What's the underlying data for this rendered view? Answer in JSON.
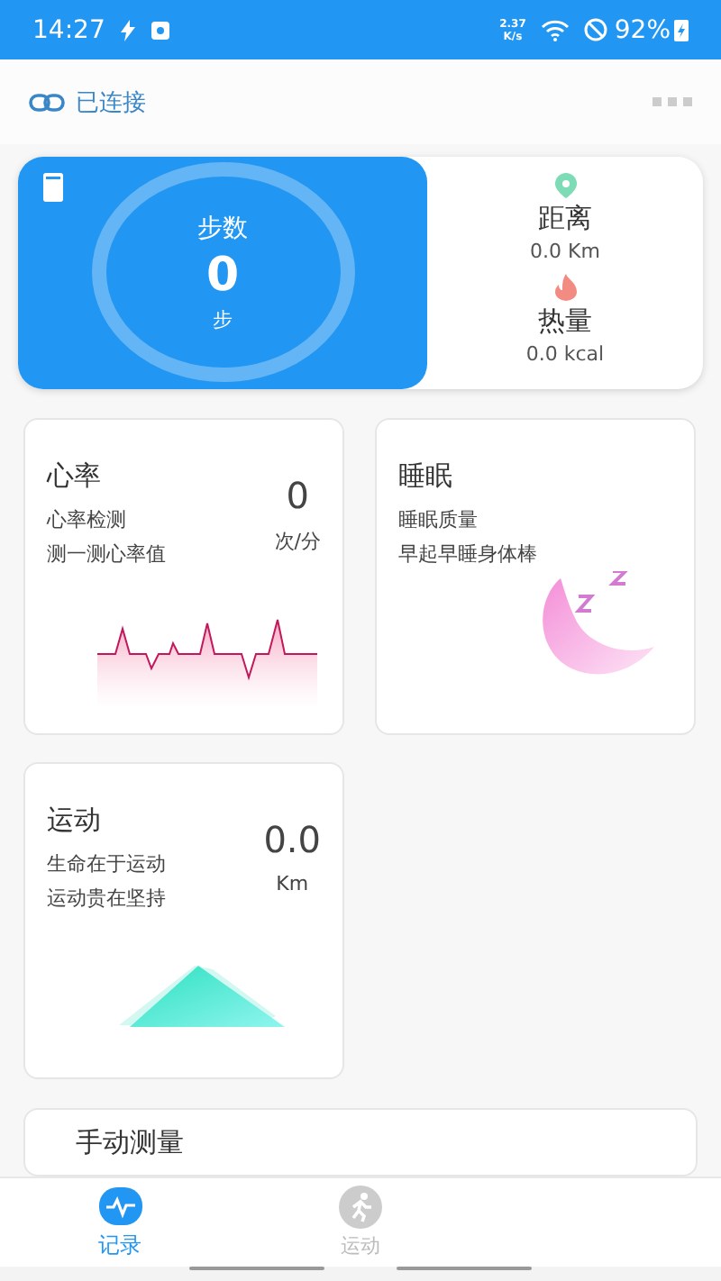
{
  "status_bar": {
    "time": "14:27",
    "speed": "2.37\nK/s",
    "battery": "92%"
  },
  "header": {
    "connection": "已连接"
  },
  "steps": {
    "title": "步数",
    "value": "0",
    "unit": "步"
  },
  "stats": [
    {
      "kind": "distance",
      "label": "距离",
      "value": "0.0 Km"
    },
    {
      "kind": "calories",
      "label": "热量",
      "value": "0.0 kcal"
    }
  ],
  "cards": [
    {
      "kind": "heart",
      "title": "心率",
      "lines": [
        "心率检测",
        "测一测心率值"
      ],
      "value": "0",
      "unit": "次/分"
    },
    {
      "kind": "sleep",
      "title": "睡眠",
      "lines": [
        "睡眠质量",
        "早起早睡身体棒"
      ]
    },
    {
      "kind": "sport",
      "title": "运动",
      "lines": [
        "生命在于运动",
        "运动贵在坚持"
      ],
      "value": "0.0",
      "unit": "Km"
    }
  ],
  "partial_card": {
    "title": "手动测量"
  },
  "tabs": [
    {
      "label": "记录",
      "selected": true,
      "kind": "record"
    },
    {
      "label": "运动",
      "selected": false,
      "kind": "sport"
    }
  ]
}
